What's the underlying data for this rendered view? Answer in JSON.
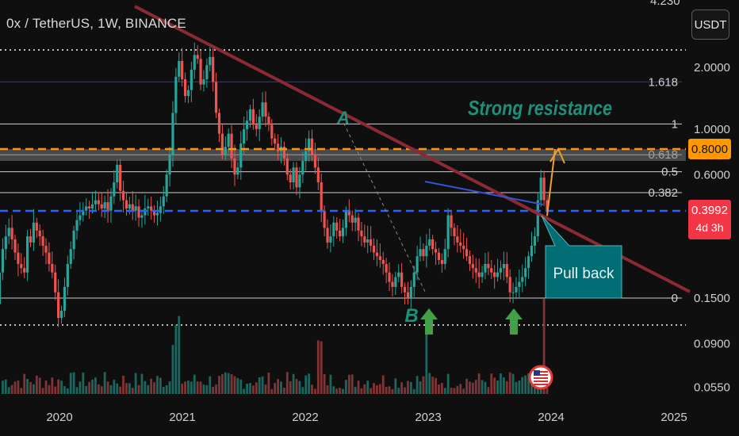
{
  "header": {
    "title": "0x / TetherUS, 1W, BINANCE",
    "currency_button": "USDT",
    "top_cut_label": "4.230"
  },
  "colors": {
    "background": "#0f0f0f",
    "up_candle": "#26a69a",
    "down_candle": "#ef5350",
    "trendline": "#8b2a35",
    "fib_line": "#cfcfcf",
    "fib_1618": "#2f3aa8",
    "orange_line": "#ff9800",
    "blue_dashed": "#2962ff",
    "annotation_teal": "#1d8f7a",
    "pullback_box": "#006d74",
    "arrow_green": "#43a047",
    "price_label_red": "#f23645"
  },
  "chart_data": {
    "type": "candlestick",
    "scale": "log",
    "x_axis": {
      "ticks": [
        "2020",
        "2021",
        "2022",
        "2023",
        "2024",
        "2025"
      ]
    },
    "y_axis": {
      "ticks": [
        "2.0000",
        "1.0000",
        "0.6000",
        "0.1500",
        "0.0900",
        "0.0550"
      ]
    },
    "fib_levels": [
      {
        "label": "1.618",
        "price": 1.7
      },
      {
        "label": "1",
        "price": 1.06
      },
      {
        "label": "0.618",
        "price": 0.75
      },
      {
        "label": "0.5",
        "price": 0.62
      },
      {
        "label": "0.382",
        "price": 0.49
      },
      {
        "label": "0",
        "price": 0.15
      }
    ],
    "horizontal_lines": [
      {
        "name": "resistance",
        "price": 0.8,
        "label": "0.8000",
        "style": "dashed",
        "color": "#ff9800"
      },
      {
        "name": "current",
        "price": 0.3992,
        "label": "0.3992",
        "sublabel": "4d 3h",
        "style": "dashed",
        "color": "#2962ff"
      }
    ],
    "resistance_zone": [
      0.7,
      0.8
    ],
    "series": [
      {
        "name": "close",
        "values": [
          0.22,
          0.28,
          0.19,
          0.15,
          0.14,
          0.2,
          0.26,
          0.3,
          0.33,
          0.29,
          0.25,
          0.22,
          0.21,
          0.2,
          0.3,
          0.28,
          0.35,
          0.32,
          0.3,
          0.27,
          0.25,
          0.22,
          0.2,
          0.16,
          0.12,
          0.13,
          0.17,
          0.22,
          0.26,
          0.32,
          0.36,
          0.38,
          0.4,
          0.42,
          0.41,
          0.43,
          0.45,
          0.43,
          0.41,
          0.44,
          0.4,
          0.47,
          0.55,
          0.67,
          0.5,
          0.45,
          0.41,
          0.43,
          0.4,
          0.42,
          0.37,
          0.38,
          0.41,
          0.42,
          0.4,
          0.38,
          0.39,
          0.42,
          0.47,
          0.6,
          0.75,
          1.2,
          1.8,
          2.15,
          1.75,
          1.45,
          1.55,
          1.95,
          2.3,
          2.2,
          1.65,
          1.75,
          2.05,
          2.25,
          1.7,
          1.2,
          0.95,
          0.75,
          0.82,
          0.95,
          0.72,
          0.6,
          0.65,
          0.85,
          1.0,
          1.1,
          1.25,
          1.05,
          1.0,
          1.15,
          1.35,
          1.15,
          1.05,
          0.9,
          0.85,
          0.78,
          0.82,
          0.72,
          0.6,
          0.55,
          0.65,
          0.52,
          0.6,
          0.7,
          0.78,
          0.9,
          0.75,
          0.65,
          0.55,
          0.4,
          0.33,
          0.28,
          0.3,
          0.35,
          0.32,
          0.3,
          0.33,
          0.4,
          0.38,
          0.35,
          0.37,
          0.32,
          0.3,
          0.28,
          0.29,
          0.27,
          0.25,
          0.24,
          0.23,
          0.22,
          0.2,
          0.18,
          0.17,
          0.19,
          0.2,
          0.17,
          0.16,
          0.15,
          0.17,
          0.2,
          0.24,
          0.26,
          0.24,
          0.27,
          0.29,
          0.26,
          0.25,
          0.23,
          0.22,
          0.26,
          0.38,
          0.33,
          0.3,
          0.28,
          0.27,
          0.26,
          0.24,
          0.22,
          0.21,
          0.2,
          0.19,
          0.2,
          0.22,
          0.21,
          0.2,
          0.19,
          0.2,
          0.21,
          0.22,
          0.19,
          0.16,
          0.16,
          0.17,
          0.18,
          0.19,
          0.21,
          0.24,
          0.27,
          0.3,
          0.45,
          0.58,
          0.45,
          0.4
        ]
      }
    ],
    "annotations": [
      {
        "label": "A",
        "price": 1.07
      },
      {
        "label": "B",
        "price": 0.15
      },
      {
        "label": "Strong resistance",
        "price": 1.3
      },
      {
        "label": "Pull back",
        "price": 0.2
      }
    ]
  },
  "annotations": {
    "a_label": "A",
    "b_label": "B",
    "strong_resistance": "Strong resistance",
    "pull_back": "Pull back"
  }
}
